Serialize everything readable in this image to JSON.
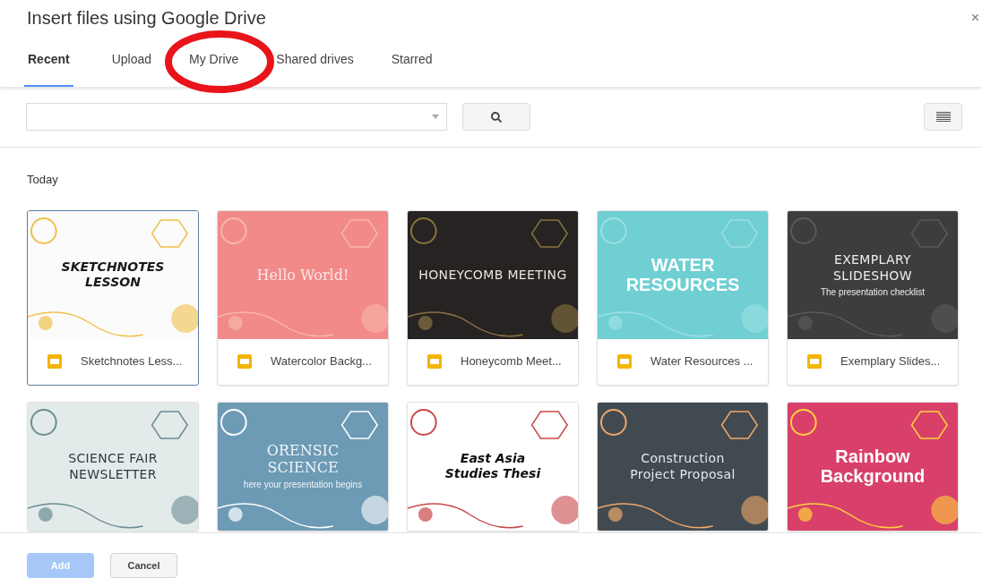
{
  "dialog": {
    "title": "Insert files using Google Drive",
    "close": "×"
  },
  "tabs": [
    {
      "label": "Recent",
      "selected": true
    },
    {
      "label": "Upload",
      "selected": false
    },
    {
      "label": "My Drive",
      "selected": false
    },
    {
      "label": "Shared drives",
      "selected": false
    },
    {
      "label": "Starred",
      "selected": false
    }
  ],
  "section": "Today",
  "files": [
    {
      "name": "Sketchnotes Less...",
      "selected": true,
      "slide": {
        "kind": "sketch",
        "title_lines": [
          "SKETCHNOTES",
          "LESSON"
        ]
      }
    },
    {
      "name": "Watercolor Backg...",
      "selected": false,
      "slide": {
        "kind": "watercolor",
        "title_lines": [
          "Hello World!"
        ]
      }
    },
    {
      "name": "Honeycomb Meet...",
      "selected": false,
      "slide": {
        "kind": "honeycomb",
        "title_lines": [
          "HONEYCOMB MEETING"
        ]
      }
    },
    {
      "name": "Water Resources ...",
      "selected": false,
      "slide": {
        "kind": "water",
        "title_lines": [
          "WATER",
          "RESOURCES"
        ]
      }
    },
    {
      "name": "Exemplary Slides...",
      "selected": false,
      "slide": {
        "kind": "dark",
        "title_lines": [
          "EXEMPLARY",
          "SLIDESHOW"
        ],
        "subtitle": "The presentation checklist"
      }
    },
    {
      "selected": false,
      "slide": {
        "kind": "science",
        "title_lines": [
          "SCIENCE FAIR",
          "NEWSLETTER"
        ]
      }
    },
    {
      "selected": false,
      "slide": {
        "kind": "forensic",
        "title_lines": [
          "ORENSIC",
          "SCIENCE"
        ],
        "subtitle": "here your presentation begins"
      }
    },
    {
      "selected": false,
      "slide": {
        "kind": "ink",
        "title_lines": [
          "East Asia",
          "Studies Thesi"
        ]
      }
    },
    {
      "selected": false,
      "slide": {
        "kind": "slate",
        "title_lines": [
          "Construction",
          "Project Proposal"
        ]
      }
    },
    {
      "selected": false,
      "slide": {
        "kind": "rainbow",
        "title_lines": [
          "Rainbow",
          "Background"
        ]
      }
    }
  ],
  "buttons": [
    {
      "label": "Add",
      "disabled": true
    },
    {
      "label": "Cancel",
      "disabled": false
    }
  ]
}
